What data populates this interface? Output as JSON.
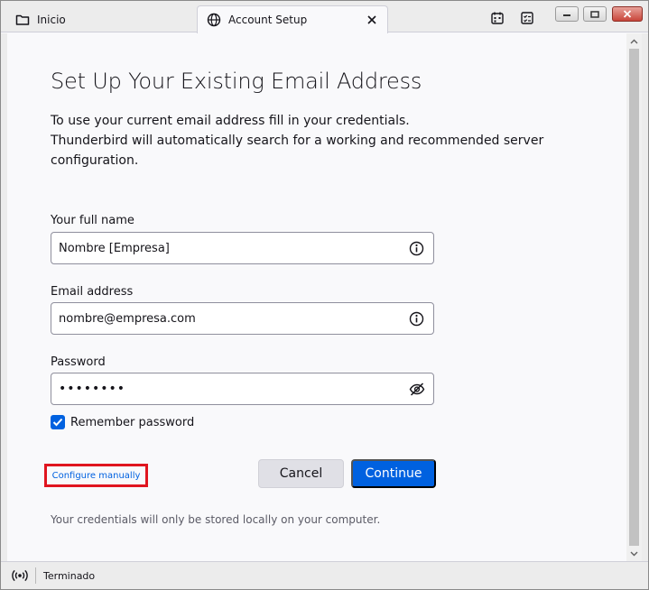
{
  "tabs": [
    {
      "label": "Inicio",
      "icon": "folder-icon"
    },
    {
      "label": "Account Setup",
      "icon": "globe-icon",
      "active": true
    }
  ],
  "page": {
    "title": "Set Up Your Existing Email Address",
    "intro_lines": [
      "To use your current email address fill in your credentials.",
      "Thunderbird will automatically search for a working and recommended server",
      "configuration."
    ]
  },
  "form": {
    "full_name_label": "Your full name",
    "full_name_value": "Nombre [Empresa]",
    "email_label": "Email address",
    "email_value": "nombre@empresa.com",
    "password_label": "Password",
    "password_value": "••••••••",
    "remember_label": "Remember password",
    "remember_checked": true
  },
  "actions": {
    "configure_manually": "Configure manually",
    "cancel": "Cancel",
    "continue": "Continue"
  },
  "note": "Your credentials will only be stored locally on your computer.",
  "status": {
    "text": "Terminado"
  },
  "colors": {
    "accent": "#0061e0",
    "highlight": "#e0151f"
  }
}
